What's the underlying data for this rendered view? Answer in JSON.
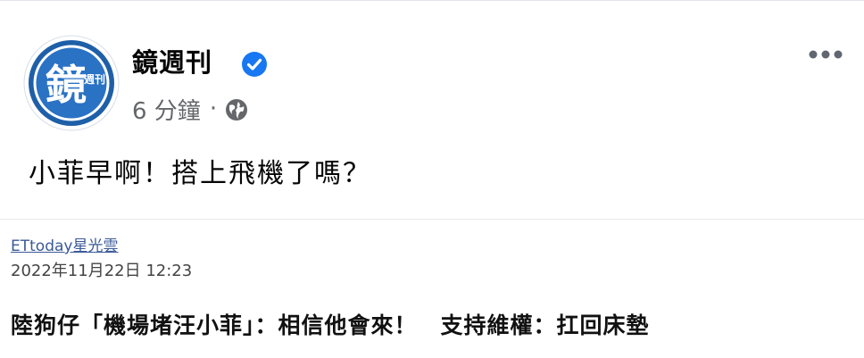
{
  "post": {
    "page_name": "鏡週刊",
    "time_ago": "6 分鐘",
    "separator": "·",
    "text": "小菲早啊！搭上飛機了嗎？"
  },
  "avatar": {
    "logo_text": "鏡",
    "sub_text": "週刊"
  },
  "link": {
    "source": "ETtoday星光雲",
    "date": "2022年11月22日 12:23",
    "title": "陸狗仔「機場堵汪小菲」：相信他會來！　支持維權：扛回床墊"
  },
  "icons": {
    "verified": "verified-badge-icon",
    "privacy": "globe-icon",
    "more": "more-options-icon"
  },
  "colors": {
    "brand_blue": "#1f5fa8",
    "verified_blue": "#1877f2",
    "meta_gray": "#65676b"
  }
}
